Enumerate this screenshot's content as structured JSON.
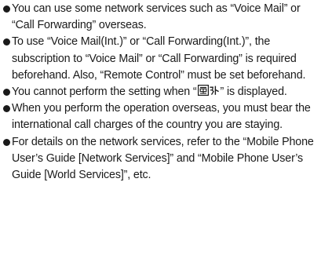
{
  "notes": [
    {
      "text": "You can use some network services such as “Voice Mail” or “Call Forwarding” overseas."
    },
    {
      "text": "To use “Voice Mail(Int.)” or “Call Forwarding(Int.)”, the subscription to “Voice Mail” or “Call Forwarding” is required beforehand. Also, “Remote Control” must be set beforehand."
    },
    {
      "before": "You cannot perform the setting when “",
      "icon": "out-of-area-icon",
      "after": "” is displayed."
    },
    {
      "text": "When you perform the operation overseas, you must bear the international call charges of the country you are staying."
    },
    {
      "text": "For details on the network services, refer to the “Mobile Phone User’s Guide [Network Services]” and “Mobile Phone User’s Guide [World Services]”, etc."
    }
  ]
}
